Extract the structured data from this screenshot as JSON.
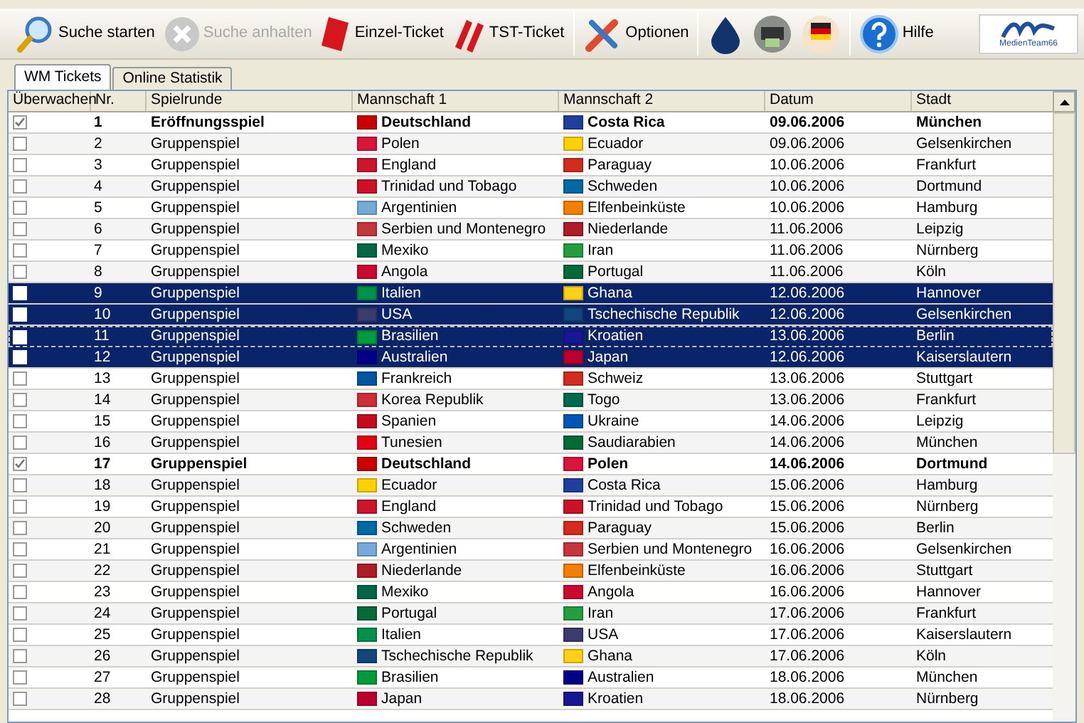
{
  "toolbar": [
    {
      "kind": "button",
      "label": "Suche starten",
      "disabled": false
    },
    {
      "kind": "button",
      "label": "Suche anhalten",
      "disabled": true
    },
    {
      "kind": "button",
      "label": "Einzel-Ticket",
      "disabled": false
    },
    {
      "kind": "button",
      "label": "TST-Ticket",
      "disabled": false
    },
    {
      "kind": "separator"
    },
    {
      "kind": "button",
      "label": "Optionen",
      "disabled": false
    },
    {
      "kind": "separator"
    },
    {
      "kind": "icon"
    },
    {
      "kind": "icon"
    },
    {
      "kind": "icon"
    },
    {
      "kind": "separator"
    },
    {
      "kind": "button",
      "label": "Hilfe",
      "disabled": false
    }
  ],
  "logo": {
    "text": "MedienTeam66"
  },
  "tabs": [
    {
      "label": "WM Tickets",
      "selected": true
    },
    {
      "label": "Online Statistik",
      "selected": false
    }
  ],
  "table": {
    "columns": [
      "Überwachen",
      "Nr.",
      "Spielrunde",
      "Mannschaft 1",
      "Mannschaft 2",
      "Datum",
      "Stadt"
    ],
    "rows": [
      {
        "checked": true,
        "selected": false,
        "focused": false,
        "nr": "1",
        "round": "Eröffnungsspiel",
        "team1": {
          "name": "Deutschland",
          "color": "#cc0000"
        },
        "team2": {
          "name": "Costa Rica",
          "color": "#1f3f9f"
        },
        "date": "09.06.2006",
        "city": "München"
      },
      {
        "checked": false,
        "selected": false,
        "focused": false,
        "nr": "2",
        "round": "Gruppenspiel",
        "team1": {
          "name": "Polen",
          "color": "#dc143c"
        },
        "team2": {
          "name": "Ecuador",
          "color": "#ffd100"
        },
        "date": "09.06.2006",
        "city": "Gelsenkirchen"
      },
      {
        "checked": false,
        "selected": false,
        "focused": false,
        "nr": "3",
        "round": "Gruppenspiel",
        "team1": {
          "name": "England",
          "color": "#cf142b"
        },
        "team2": {
          "name": "Paraguay",
          "color": "#d52b1e"
        },
        "date": "10.06.2006",
        "city": "Frankfurt"
      },
      {
        "checked": false,
        "selected": false,
        "focused": false,
        "nr": "4",
        "round": "Gruppenspiel",
        "team1": {
          "name": "Trinidad und Tobago",
          "color": "#ce1126"
        },
        "team2": {
          "name": "Schweden",
          "color": "#006aa7"
        },
        "date": "10.06.2006",
        "city": "Dortmund"
      },
      {
        "checked": false,
        "selected": false,
        "focused": false,
        "nr": "5",
        "round": "Gruppenspiel",
        "team1": {
          "name": "Argentinien",
          "color": "#75aadb"
        },
        "team2": {
          "name": "Elfenbeinküste",
          "color": "#f77f00"
        },
        "date": "10.06.2006",
        "city": "Hamburg"
      },
      {
        "checked": false,
        "selected": false,
        "focused": false,
        "nr": "6",
        "round": "Gruppenspiel",
        "team1": {
          "name": "Serbien und Montenegro",
          "color": "#c6363c"
        },
        "team2": {
          "name": "Niederlande",
          "color": "#ae1c28"
        },
        "date": "11.06.2006",
        "city": "Leipzig"
      },
      {
        "checked": false,
        "selected": false,
        "focused": false,
        "nr": "7",
        "round": "Gruppenspiel",
        "team1": {
          "name": "Mexiko",
          "color": "#006847"
        },
        "team2": {
          "name": "Iran",
          "color": "#239f40"
        },
        "date": "11.06.2006",
        "city": "Nürnberg"
      },
      {
        "checked": false,
        "selected": false,
        "focused": false,
        "nr": "8",
        "round": "Gruppenspiel",
        "team1": {
          "name": "Angola",
          "color": "#cc092f"
        },
        "team2": {
          "name": "Portugal",
          "color": "#046a38"
        },
        "date": "11.06.2006",
        "city": "Köln"
      },
      {
        "checked": false,
        "selected": true,
        "focused": false,
        "nr": "9",
        "round": "Gruppenspiel",
        "team1": {
          "name": "Italien",
          "color": "#009246"
        },
        "team2": {
          "name": "Ghana",
          "color": "#fcd116"
        },
        "date": "12.06.2006",
        "city": "Hannover"
      },
      {
        "checked": false,
        "selected": true,
        "focused": false,
        "nr": "10",
        "round": "Gruppenspiel",
        "team1": {
          "name": "USA",
          "color": "#3c3b6e"
        },
        "team2": {
          "name": "Tschechische Republik",
          "color": "#11457e"
        },
        "date": "12.06.2006",
        "city": "Gelsenkirchen"
      },
      {
        "checked": false,
        "selected": true,
        "focused": true,
        "nr": "11",
        "round": "Gruppenspiel",
        "team1": {
          "name": "Brasilien",
          "color": "#009c3b"
        },
        "team2": {
          "name": "Kroatien",
          "color": "#171796"
        },
        "date": "13.06.2006",
        "city": "Berlin"
      },
      {
        "checked": false,
        "selected": true,
        "focused": false,
        "nr": "12",
        "round": "Gruppenspiel",
        "team1": {
          "name": "Australien",
          "color": "#00008b"
        },
        "team2": {
          "name": "Japan",
          "color": "#bc002d"
        },
        "date": "12.06.2006",
        "city": "Kaiserslautern"
      },
      {
        "checked": false,
        "selected": false,
        "focused": false,
        "nr": "13",
        "round": "Gruppenspiel",
        "team1": {
          "name": "Frankreich",
          "color": "#0055a4"
        },
        "team2": {
          "name": "Schweiz",
          "color": "#d52b1e"
        },
        "date": "13.06.2006",
        "city": "Stuttgart"
      },
      {
        "checked": false,
        "selected": false,
        "focused": false,
        "nr": "14",
        "round": "Gruppenspiel",
        "team1": {
          "name": "Korea Republik",
          "color": "#cd2e3a"
        },
        "team2": {
          "name": "Togo",
          "color": "#006a4e"
        },
        "date": "13.06.2006",
        "city": "Frankfurt"
      },
      {
        "checked": false,
        "selected": false,
        "focused": false,
        "nr": "15",
        "round": "Gruppenspiel",
        "team1": {
          "name": "Spanien",
          "color": "#c60b1e"
        },
        "team2": {
          "name": "Ukraine",
          "color": "#0057b7"
        },
        "date": "14.06.2006",
        "city": "Leipzig"
      },
      {
        "checked": false,
        "selected": false,
        "focused": false,
        "nr": "16",
        "round": "Gruppenspiel",
        "team1": {
          "name": "Tunesien",
          "color": "#e70013"
        },
        "team2": {
          "name": "Saudiarabien",
          "color": "#006c35"
        },
        "date": "14.06.2006",
        "city": "München"
      },
      {
        "checked": true,
        "selected": false,
        "focused": false,
        "nr": "17",
        "round": "Gruppenspiel",
        "team1": {
          "name": "Deutschland",
          "color": "#cc0000"
        },
        "team2": {
          "name": "Polen",
          "color": "#dc143c"
        },
        "date": "14.06.2006",
        "city": "Dortmund"
      },
      {
        "checked": false,
        "selected": false,
        "focused": false,
        "nr": "18",
        "round": "Gruppenspiel",
        "team1": {
          "name": "Ecuador",
          "color": "#ffd100"
        },
        "team2": {
          "name": "Costa Rica",
          "color": "#1f3f9f"
        },
        "date": "15.06.2006",
        "city": "Hamburg"
      },
      {
        "checked": false,
        "selected": false,
        "focused": false,
        "nr": "19",
        "round": "Gruppenspiel",
        "team1": {
          "name": "England",
          "color": "#cf142b"
        },
        "team2": {
          "name": "Trinidad und Tobago",
          "color": "#ce1126"
        },
        "date": "15.06.2006",
        "city": "Nürnberg"
      },
      {
        "checked": false,
        "selected": false,
        "focused": false,
        "nr": "20",
        "round": "Gruppenspiel",
        "team1": {
          "name": "Schweden",
          "color": "#006aa7"
        },
        "team2": {
          "name": "Paraguay",
          "color": "#d52b1e"
        },
        "date": "15.06.2006",
        "city": "Berlin"
      },
      {
        "checked": false,
        "selected": false,
        "focused": false,
        "nr": "21",
        "round": "Gruppenspiel",
        "team1": {
          "name": "Argentinien",
          "color": "#75aadb"
        },
        "team2": {
          "name": "Serbien und Montenegro",
          "color": "#c6363c"
        },
        "date": "16.06.2006",
        "city": "Gelsenkirchen"
      },
      {
        "checked": false,
        "selected": false,
        "focused": false,
        "nr": "22",
        "round": "Gruppenspiel",
        "team1": {
          "name": "Niederlande",
          "color": "#ae1c28"
        },
        "team2": {
          "name": "Elfenbeinküste",
          "color": "#f77f00"
        },
        "date": "16.06.2006",
        "city": "Stuttgart"
      },
      {
        "checked": false,
        "selected": false,
        "focused": false,
        "nr": "23",
        "round": "Gruppenspiel",
        "team1": {
          "name": "Mexiko",
          "color": "#006847"
        },
        "team2": {
          "name": "Angola",
          "color": "#cc092f"
        },
        "date": "16.06.2006",
        "city": "Hannover"
      },
      {
        "checked": false,
        "selected": false,
        "focused": false,
        "nr": "24",
        "round": "Gruppenspiel",
        "team1": {
          "name": "Portugal",
          "color": "#046a38"
        },
        "team2": {
          "name": "Iran",
          "color": "#239f40"
        },
        "date": "17.06.2006",
        "city": "Frankfurt"
      },
      {
        "checked": false,
        "selected": false,
        "focused": false,
        "nr": "25",
        "round": "Gruppenspiel",
        "team1": {
          "name": "Italien",
          "color": "#009246"
        },
        "team2": {
          "name": "USA",
          "color": "#3c3b6e"
        },
        "date": "17.06.2006",
        "city": "Kaiserslautern"
      },
      {
        "checked": false,
        "selected": false,
        "focused": false,
        "nr": "26",
        "round": "Gruppenspiel",
        "team1": {
          "name": "Tschechische Republik",
          "color": "#11457e"
        },
        "team2": {
          "name": "Ghana",
          "color": "#fcd116"
        },
        "date": "17.06.2006",
        "city": "Köln"
      },
      {
        "checked": false,
        "selected": false,
        "focused": false,
        "nr": "27",
        "round": "Gruppenspiel",
        "team1": {
          "name": "Brasilien",
          "color": "#009c3b"
        },
        "team2": {
          "name": "Australien",
          "color": "#00008b"
        },
        "date": "18.06.2006",
        "city": "München"
      },
      {
        "checked": false,
        "selected": false,
        "focused": false,
        "nr": "28",
        "round": "Gruppenspiel",
        "team1": {
          "name": "Japan",
          "color": "#bc002d"
        },
        "team2": {
          "name": "Kroatien",
          "color": "#171796"
        },
        "date": "18.06.2006",
        "city": "Nürnberg"
      }
    ]
  }
}
